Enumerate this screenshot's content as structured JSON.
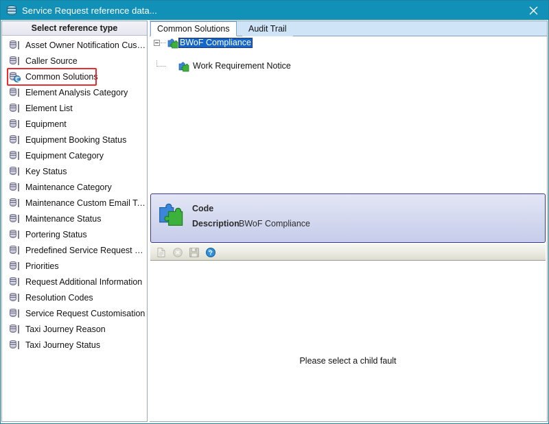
{
  "window": {
    "title": "Service Request reference data...",
    "title_icon": "database-icon",
    "close_label": "×",
    "titlebar_color": "#1291b8"
  },
  "sidebar": {
    "header": "Select reference type",
    "selected_item": "Common Solutions",
    "items": [
      {
        "label": "Asset Owner Notification Custom...",
        "icon": "database-icon"
      },
      {
        "label": "Caller Source",
        "icon": "database-icon"
      },
      {
        "label": "Common Solutions",
        "icon": "database-refresh-icon"
      },
      {
        "label": "Element Analysis Category",
        "icon": "database-icon"
      },
      {
        "label": "Element List",
        "icon": "database-icon"
      },
      {
        "label": "Equipment",
        "icon": "database-icon"
      },
      {
        "label": "Equipment Booking Status",
        "icon": "database-icon"
      },
      {
        "label": "Equipment Category",
        "icon": "database-icon"
      },
      {
        "label": "Key Status",
        "icon": "database-icon"
      },
      {
        "label": "Maintenance Category",
        "icon": "database-icon"
      },
      {
        "label": "Maintenance Custom Email Text",
        "icon": "database-icon"
      },
      {
        "label": "Maintenance Status",
        "icon": "database-icon"
      },
      {
        "label": "Portering Status",
        "icon": "database-icon"
      },
      {
        "label": "Predefined Service Request Events",
        "icon": "database-icon"
      },
      {
        "label": "Priorities",
        "icon": "database-icon"
      },
      {
        "label": "Request Additional Information",
        "icon": "database-icon"
      },
      {
        "label": "Resolution Codes",
        "icon": "database-icon"
      },
      {
        "label": "Service Request Customisation",
        "icon": "database-icon"
      },
      {
        "label": "Taxi Journey Reason",
        "icon": "database-icon"
      },
      {
        "label": "Taxi Journey Status",
        "icon": "database-icon"
      }
    ],
    "highlight_color": "#ec2c2c"
  },
  "content": {
    "tabs": [
      {
        "label": "Common Solutions",
        "active": true
      },
      {
        "label": "Audit Trail",
        "active": false
      }
    ],
    "tree": {
      "root": {
        "label": "BWoF Compliance",
        "icon": "puzzle-icon",
        "selected": true,
        "expanded": true
      },
      "children": [
        {
          "label": "Work Requirement Notice",
          "icon": "puzzle-icon",
          "selected": false
        }
      ]
    },
    "detail": {
      "icon": "puzzle-icon",
      "code_label": "Code",
      "code_value": "",
      "description_label": "Description",
      "description_value": "BWoF Compliance"
    },
    "toolbar": [
      {
        "name": "new-icon",
        "label": "New",
        "enabled": false
      },
      {
        "name": "delete-icon",
        "label": "Delete",
        "enabled": false
      },
      {
        "name": "save-icon",
        "label": "Save",
        "enabled": false
      },
      {
        "name": "help-icon",
        "label": "Help",
        "enabled": true
      }
    ],
    "empty_message": "Please select a child fault"
  }
}
